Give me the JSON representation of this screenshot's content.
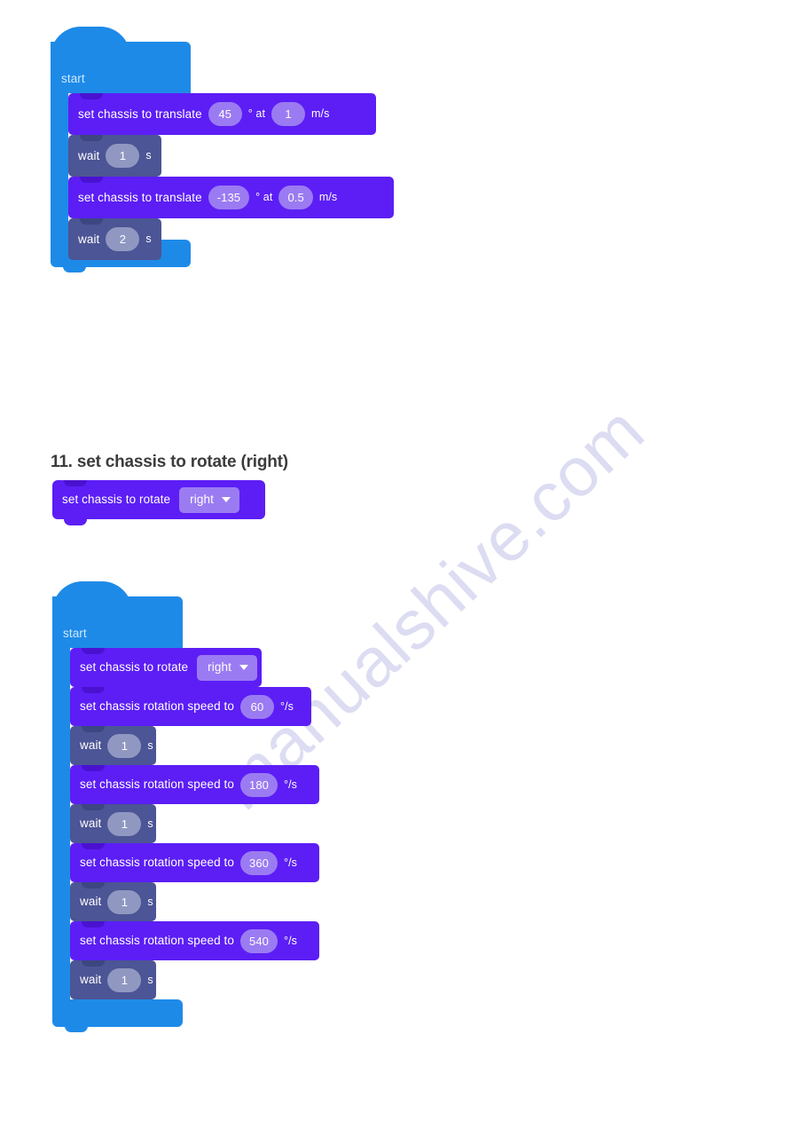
{
  "page": {
    "watermark": "manualshive.com",
    "background_color": "#ffffff"
  },
  "colors": {
    "hat_blue": "#1e8ae8",
    "motion_purple": "#5c1ef5",
    "wait_slate": "#4c5595",
    "field_light_purple": "#9b7bf2",
    "field_wait_gray": "#9098c2",
    "heading_text": "#3c3c3c",
    "watermark_text": "#dcdcf2"
  },
  "sections": [
    {
      "id": "translate-example",
      "heading": null,
      "script": {
        "hat_label": "start",
        "blocks": [
          {
            "type": "motion",
            "label": "set chassis to translate",
            "value1": "45",
            "mid_label": "° at",
            "value2": "1",
            "unit": "m/s"
          },
          {
            "type": "wait",
            "label": "wait",
            "value1": "1",
            "unit": "s"
          },
          {
            "type": "motion",
            "label": "set chassis to translate",
            "value1": "-135",
            "mid_label": "° at",
            "value2": "0.5",
            "unit": "m/s"
          },
          {
            "type": "wait",
            "label": "wait",
            "value1": "2",
            "unit": "s"
          }
        ]
      }
    },
    {
      "id": "rotate-right",
      "heading": "11. set chassis to rotate (right)",
      "standalone_block": {
        "type": "motion",
        "label": "set chassis to rotate",
        "dropdown_value": "right"
      },
      "script": {
        "hat_label": "start",
        "blocks": [
          {
            "type": "motion",
            "label": "set chassis to rotate",
            "dropdown_value": "right"
          },
          {
            "type": "motion",
            "label": "set chassis rotation speed to",
            "value1": "60",
            "unit": "°/s"
          },
          {
            "type": "wait",
            "label": "wait",
            "value1": "1",
            "unit": "s"
          },
          {
            "type": "motion",
            "label": "set chassis rotation speed to",
            "value1": "180",
            "unit": "°/s"
          },
          {
            "type": "wait",
            "label": "wait",
            "value1": "1",
            "unit": "s"
          },
          {
            "type": "motion",
            "label": "set chassis rotation speed to",
            "value1": "360",
            "unit": "°/s"
          },
          {
            "type": "wait",
            "label": "wait",
            "value1": "1",
            "unit": "s"
          },
          {
            "type": "motion",
            "label": "set chassis rotation speed to",
            "value1": "540",
            "unit": "°/s"
          },
          {
            "type": "wait",
            "label": "wait",
            "value1": "1",
            "unit": "s"
          }
        ]
      }
    }
  ]
}
